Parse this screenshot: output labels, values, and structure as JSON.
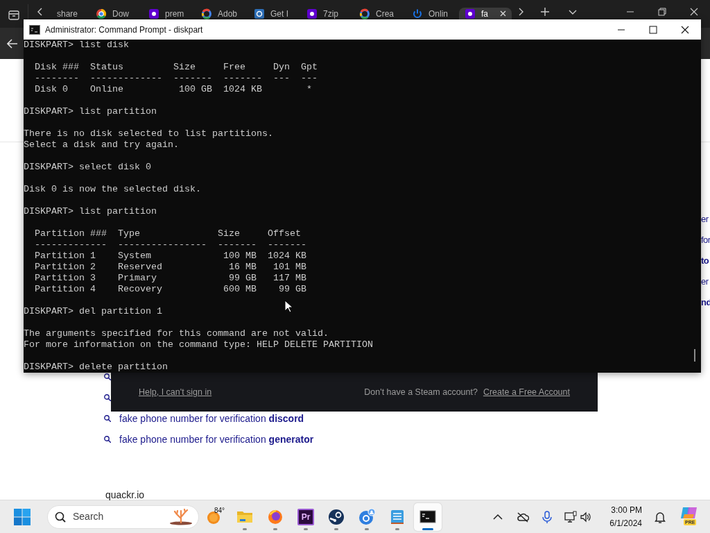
{
  "browser": {
    "tabs": [
      {
        "label": "share",
        "kind": "plain",
        "selected": false
      },
      {
        "label": "Dow",
        "kind": "chrome",
        "selected": false
      },
      {
        "label": "prem",
        "kind": "yahoo",
        "selected": false
      },
      {
        "label": "Adob",
        "kind": "google",
        "selected": false
      },
      {
        "label": "Get I",
        "kind": "shield",
        "selected": false
      },
      {
        "label": "7zip",
        "kind": "yahoo",
        "selected": false
      },
      {
        "label": "Crea",
        "kind": "google",
        "selected": false
      },
      {
        "label": "Onlin",
        "kind": "power",
        "selected": false
      },
      {
        "label": "fa",
        "kind": "yahoo",
        "selected": true
      }
    ]
  },
  "page": {
    "side_fragments": [
      {
        "text": "er",
        "bold": false
      },
      {
        "text": "for",
        "bold": false
      },
      {
        "text": "to",
        "bold": true
      },
      {
        "text": "er",
        "bold": false
      },
      {
        "text": "nd",
        "bold": true
      }
    ],
    "suggestions": [
      {
        "text": "fake phone number for verification **discord**"
      },
      {
        "text": "fake phone number for verification **generator**"
      }
    ],
    "footer_site": "quackr.io"
  },
  "steam_panel": {
    "help_link": "Help, I can't sign in",
    "prompt": "Don't have a Steam account?",
    "create_link": "Create a Free Account"
  },
  "console": {
    "window_title": "Administrator: Command Prompt - diskpart",
    "blocks": [
      [
        "DISKPART> list disk"
      ],
      [
        "  Disk ###  Status         Size     Free     Dyn  Gpt",
        "  --------  -------------  -------  -------  ---  ---",
        "  Disk 0    Online          100 GB  1024 KB        *"
      ],
      [
        "DISKPART> list partition"
      ],
      [
        "There is no disk selected to list partitions.",
        "Select a disk and try again."
      ],
      [
        "DISKPART> select disk 0"
      ],
      [
        "Disk 0 is now the selected disk."
      ],
      [
        "DISKPART> list partition"
      ],
      [
        "  Partition ###  Type              Size     Offset",
        "  -------------  ----------------  -------  -------",
        "  Partition 1    System             100 MB  1024 KB",
        "  Partition 2    Reserved            16 MB   101 MB",
        "  Partition 3    Primary             99 GB   117 MB",
        "  Partition 4    Recovery           600 MB    99 GB"
      ],
      [
        "DISKPART> del partition 1"
      ],
      [
        "The arguments specified for this command are not valid.",
        "For more information on the command type: HELP DELETE PARTITION"
      ],
      [
        "DISKPART> delete partition"
      ]
    ]
  },
  "taskbar": {
    "search_placeholder": "Search",
    "weather_temp": "84°",
    "apps": [
      {
        "kind": "folder",
        "running": true,
        "selected": false
      },
      {
        "kind": "browser",
        "running": true,
        "selected": false
      },
      {
        "kind": "video_editor",
        "label": "Pr",
        "running": true,
        "selected": false
      },
      {
        "kind": "game_store",
        "running": true,
        "selected": false
      },
      {
        "kind": "profile_app",
        "running": true,
        "selected": false
      },
      {
        "kind": "notepad",
        "running": true,
        "selected": false
      },
      {
        "kind": "terminal",
        "running": true,
        "selected": true
      }
    ],
    "time": "3:00 PM",
    "date": "6/1/2024",
    "assistant_badge": "PRE"
  }
}
